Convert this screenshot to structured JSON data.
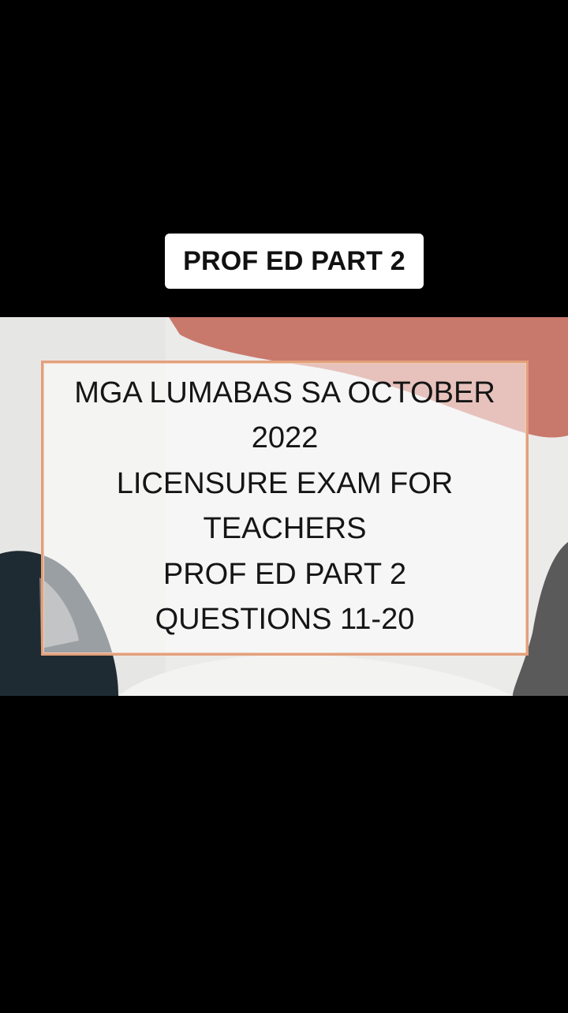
{
  "caption": {
    "label": "PROF ED PART 2"
  },
  "slide": {
    "title_lines": [
      "MGA LUMABAS SA OCTOBER",
      "2022",
      "LICENSURE EXAM FOR",
      "TEACHERS",
      "PROF ED PART 2",
      "QUESTIONS 11-20"
    ]
  },
  "colors": {
    "background": "#000000",
    "caption_bg": "#ffffff",
    "slide_base": "#ebebea",
    "blob_coral": "#c9786c",
    "blob_dark_teal": "#1f2b33",
    "blob_gray": "#9a9a9a",
    "card_border": "#e3a07c"
  }
}
